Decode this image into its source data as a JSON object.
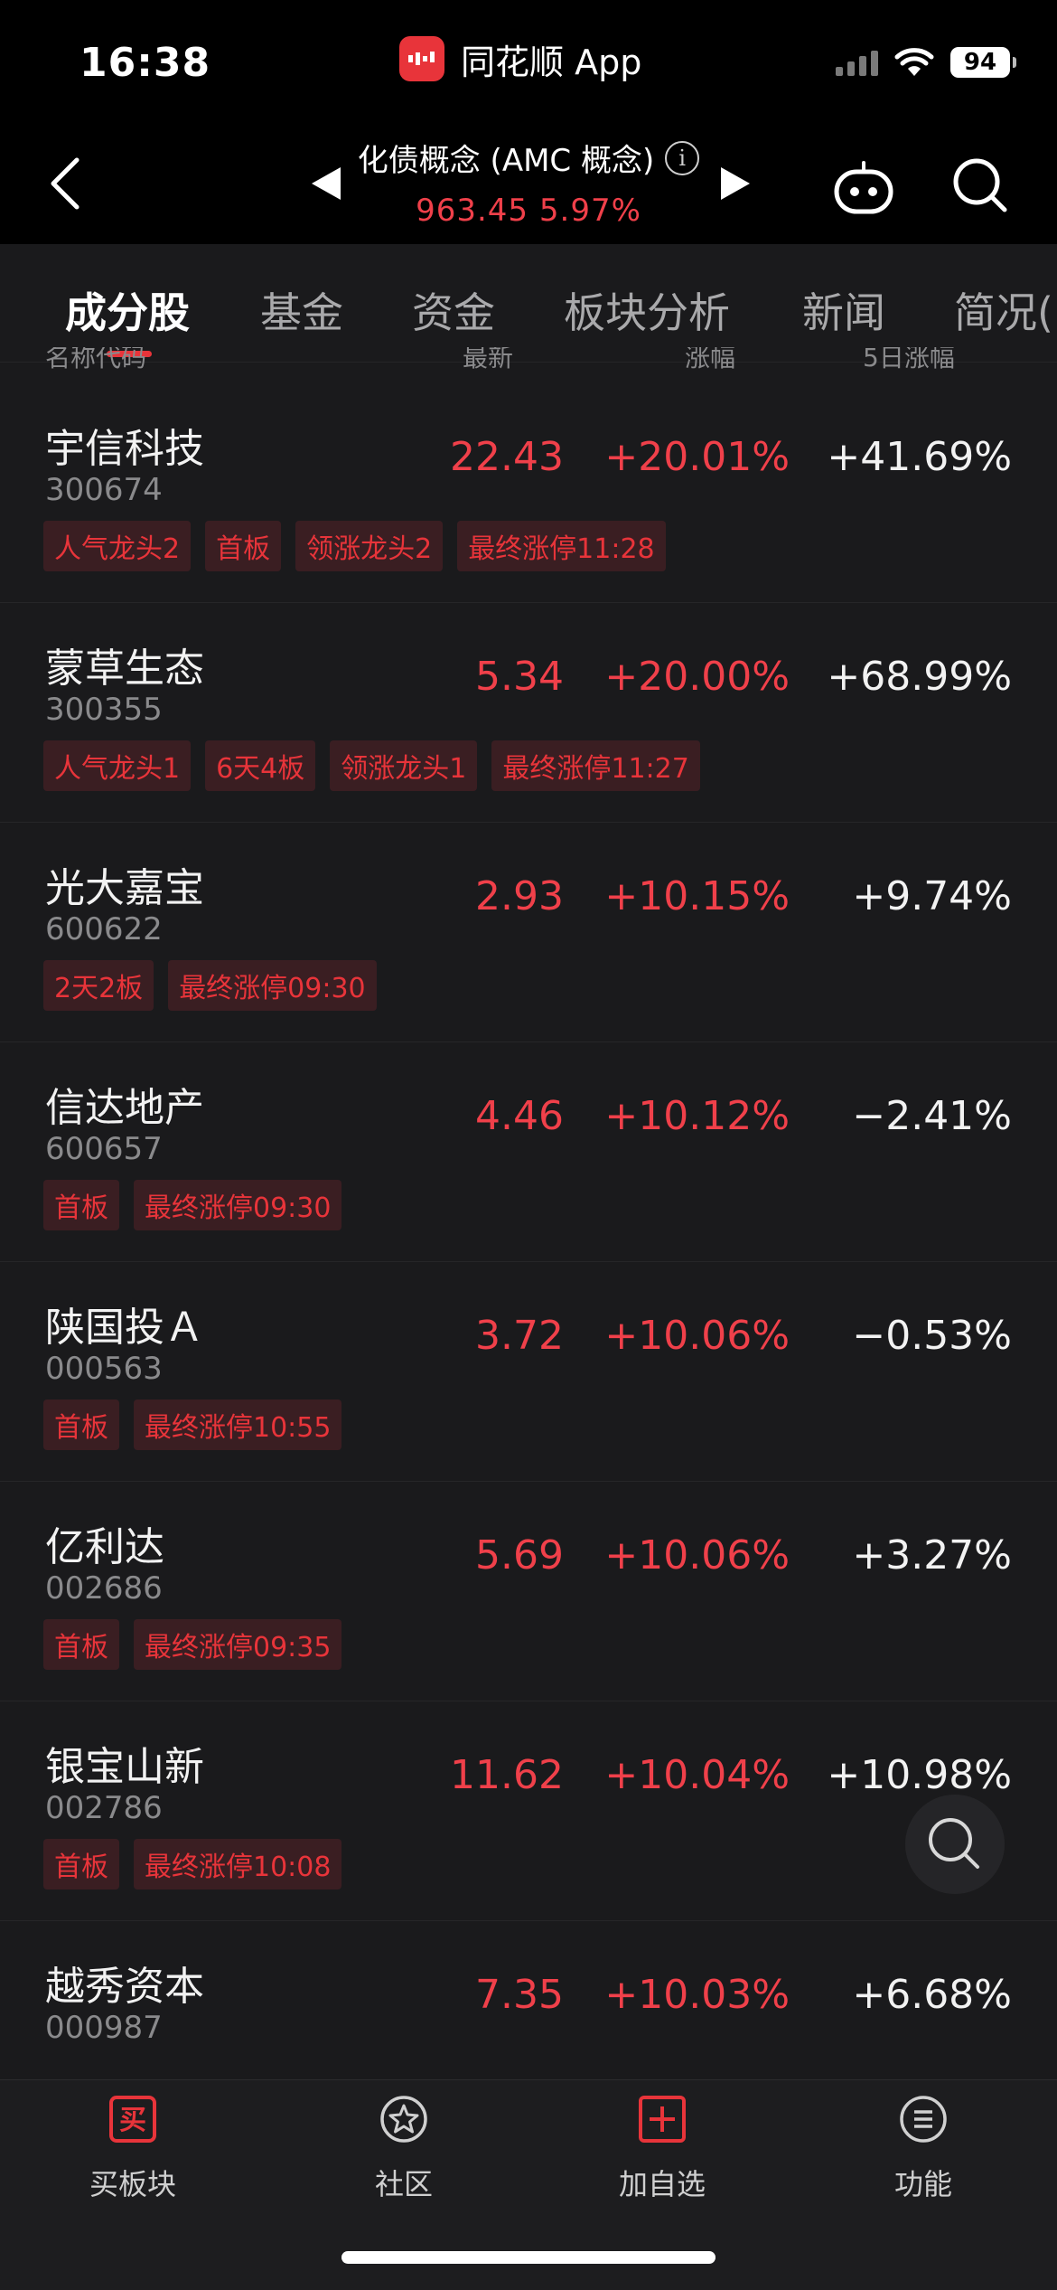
{
  "status": {
    "time": "16:38",
    "app_name": "同花顺 App",
    "battery": "94"
  },
  "header": {
    "title": "化债概念 (AMC 概念)",
    "info_glyph": "i",
    "price": "963.45",
    "change_pct": "5.97%"
  },
  "tabs": [
    {
      "label": "成分股"
    },
    {
      "label": "基金"
    },
    {
      "label": "资金"
    },
    {
      "label": "板块分析"
    },
    {
      "label": "新闻"
    },
    {
      "label": "简况("
    }
  ],
  "columns": {
    "name": "名称代码",
    "price": "最新",
    "change": "涨幅",
    "chg5": "5日涨幅"
  },
  "rows": [
    {
      "name": "宇信科技",
      "code": "300674",
      "price": "22.43",
      "change": "+20.01%",
      "chg5": "+41.69%",
      "tags": [
        "人气龙头2",
        "首板",
        "领涨龙头2",
        "最终涨停11:28"
      ]
    },
    {
      "name": "蒙草生态",
      "code": "300355",
      "price": "5.34",
      "change": "+20.00%",
      "chg5": "+68.99%",
      "tags": [
        "人气龙头1",
        "6天4板",
        "领涨龙头1",
        "最终涨停11:27"
      ]
    },
    {
      "name": "光大嘉宝",
      "code": "600622",
      "price": "2.93",
      "change": "+10.15%",
      "chg5": "+9.74%",
      "tags": [
        "2天2板",
        "最终涨停09:30"
      ]
    },
    {
      "name": "信达地产",
      "code": "600657",
      "price": "4.46",
      "change": "+10.12%",
      "chg5": "−2.41%",
      "tags": [
        "首板",
        "最终涨停09:30"
      ]
    },
    {
      "name": "陕国投Ａ",
      "code": "000563",
      "price": "3.72",
      "change": "+10.06%",
      "chg5": "−0.53%",
      "tags": [
        "首板",
        "最终涨停10:55"
      ]
    },
    {
      "name": "亿利达",
      "code": "002686",
      "price": "5.69",
      "change": "+10.06%",
      "chg5": "+3.27%",
      "tags": [
        "首板",
        "最终涨停09:35"
      ]
    },
    {
      "name": "银宝山新",
      "code": "002786",
      "price": "11.62",
      "change": "+10.04%",
      "chg5": "+10.98%",
      "tags": [
        "首板",
        "最终涨停10:08"
      ]
    },
    {
      "name": "越秀资本",
      "code": "000987",
      "price": "7.35",
      "change": "+10.03%",
      "chg5": "+6.68%",
      "tags": []
    }
  ],
  "nav": [
    {
      "label": "买板块",
      "icon": "buy-icon",
      "glyph": "买"
    },
    {
      "label": "社区",
      "icon": "community-icon"
    },
    {
      "label": "加自选",
      "icon": "add-watchlist-icon"
    },
    {
      "label": "功能",
      "icon": "menu-icon"
    }
  ],
  "colors": {
    "up": "#f0404a",
    "accent": "#e8343a",
    "tag_bg": "#3a1e22",
    "background": "#1a1a1c"
  }
}
